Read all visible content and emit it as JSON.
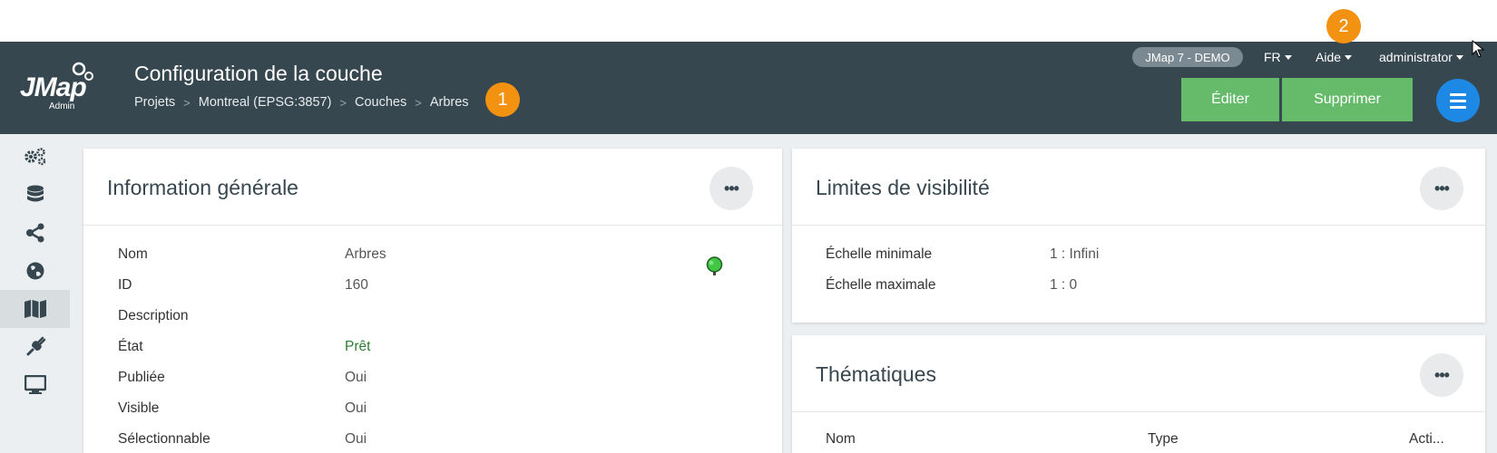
{
  "header": {
    "logo_text": "JMap",
    "logo_sub": "Admin",
    "title": "Configuration de la couche",
    "breadcrumb": [
      "Projets",
      "Montreal (EPSG:3857)",
      "Couches",
      "Arbres"
    ],
    "env_badge": "JMap 7 - DEMO",
    "lang": "FR",
    "help": "Aide",
    "user": "administrator",
    "edit_label": "Éditer",
    "delete_label": "Supprimer"
  },
  "callouts": [
    "1",
    "2"
  ],
  "sidebar": {
    "items": [
      {
        "icon": "gears-icon"
      },
      {
        "icon": "database-icon"
      },
      {
        "icon": "share-icon"
      },
      {
        "icon": "globe-icon"
      },
      {
        "icon": "map-icon",
        "active": true
      },
      {
        "icon": "plug-icon"
      },
      {
        "icon": "monitor-icon"
      }
    ]
  },
  "general_info": {
    "title": "Information générale",
    "rows": [
      {
        "label": "Nom",
        "value": "Arbres"
      },
      {
        "label": "ID",
        "value": "160"
      },
      {
        "label": "Description",
        "value": ""
      },
      {
        "label": "État",
        "value": "Prêt",
        "color": "#2e7d32"
      },
      {
        "label": "Publiée",
        "value": "Oui"
      },
      {
        "label": "Visible",
        "value": "Oui"
      },
      {
        "label": "Sélectionnable",
        "value": "Oui"
      }
    ]
  },
  "visibility": {
    "title": "Limites de visibilité",
    "rows": [
      {
        "label": "Échelle minimale",
        "value": "1 : Infini"
      },
      {
        "label": "Échelle maximale",
        "value": "1 : 0"
      }
    ]
  },
  "thematics": {
    "title": "Thématiques",
    "columns": [
      "Nom",
      "Type",
      "Acti..."
    ]
  },
  "colors": {
    "header_bg": "#37474f",
    "accent_green": "#66bb6a",
    "accent_blue": "#1e88e5",
    "callout_orange": "#f39111"
  }
}
